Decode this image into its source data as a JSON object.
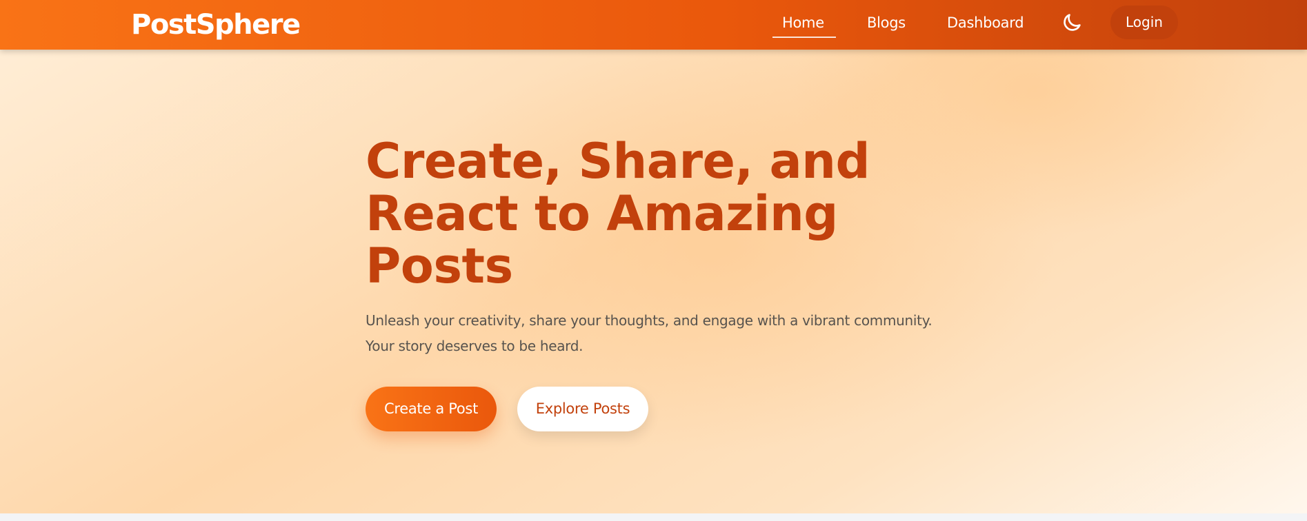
{
  "navbar": {
    "logo": "PostSphere",
    "links": [
      {
        "label": "Home",
        "active": true
      },
      {
        "label": "Blogs",
        "active": false
      },
      {
        "label": "Dashboard",
        "active": false
      }
    ],
    "theme_toggle_icon": "moon-icon",
    "login_label": "Login"
  },
  "hero": {
    "title": "Create, Share, and React to Amazing Posts",
    "subtitle_line1": "Unleash your creativity, share your thoughts, and engage with a vibrant community.",
    "subtitle_line2": "Your story deserves to be heard.",
    "primary_button": "Create a Post",
    "secondary_button": "Explore Posts"
  },
  "colors": {
    "brand_orange": "#f97316",
    "brand_dark": "#c2410c",
    "hero_bg": "#fed7aa"
  }
}
